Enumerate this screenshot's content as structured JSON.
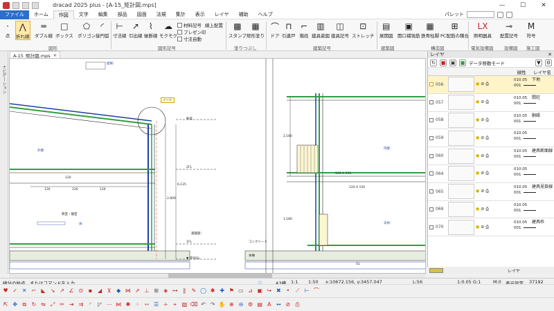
{
  "app": {
    "title": "dracad 2025 plus - [A-15_矩計図.mps]"
  },
  "window": {
    "minimize": "—",
    "maximize": "☐",
    "close": "✕"
  },
  "menu": [
    "ファイル",
    "ホーム",
    "作図",
    "文字",
    "編集",
    "部品",
    "図面",
    "法規",
    "集計",
    "表示",
    "レイヤ",
    "補助",
    "ヘルプ"
  ],
  "menu_right": {
    "palette_label": "パレット"
  },
  "ribbon": {
    "buttons": [
      "点",
      "折れ線",
      "ダブル線",
      "ボックス",
      "ポリゴン",
      "接円弧",
      "寸法線",
      "引出線",
      "破断線",
      "モクモク",
      "スタンプ",
      "矩形塗り",
      "ドア",
      "引違戸",
      "階段",
      "建具姿図",
      "建具記号",
      "ストレッチ",
      "展開図",
      "開口補強筋",
      "鉄骨柱脚",
      "PC配筋の積合",
      "照明器具",
      "配置記号",
      "符号"
    ],
    "small": [
      "材料記号",
      "プレゼン印",
      "寸法自動",
      "線上配置"
    ],
    "groups": [
      "図形",
      "図形記号",
      "塗りつぶし",
      "建築記号",
      "建築図",
      "構造図",
      "電気設備図",
      "設備図",
      "施工図"
    ]
  },
  "document": {
    "tab_label": "A-15_矩計図.mps",
    "close": "×"
  },
  "side_tab": "ナビゲーション",
  "canvas_labels": {
    "section_marks": [
      "軒高",
      "2FL",
      "1FL",
      "▼ 平均GL"
    ],
    "rooms": [
      "和室・寝室",
      "本棟"
    ],
    "callouts": [
      "屋根:",
      "外壁:",
      "内壁:",
      "床:",
      "天井:"
    ],
    "dims": [
      "120",
      "126",
      "126",
      "126",
      "2,800",
      "6,135",
      "2,160",
      "1,180",
      "120 X 150",
      "120 X 150"
    ],
    "notes": [
      "基礎部:",
      "コンクリート",
      "GL"
    ],
    "status_bubble": "ノート"
  },
  "layer_panel": {
    "title": "レイヤ",
    "close": "✕",
    "mode_label": "データ移動モード",
    "columns": [
      "",
      "顔性",
      "レイヤ名"
    ],
    "rows": [
      {
        "num": "056",
        "color": "010.05",
        "name": "下地"
      },
      {
        "num": "057",
        "color": "010.05",
        "name": "間柱"
      },
      {
        "num": "058",
        "color": "010.05",
        "name": "胴縁"
      },
      {
        "num": "059",
        "color": "010.05",
        "name": ""
      },
      {
        "num": "060",
        "color": "010.05",
        "name": "建具断面線"
      },
      {
        "num": "064",
        "color": "010.05",
        "name": ""
      },
      {
        "num": "065",
        "color": "010.05",
        "name": "建具見掛線"
      },
      {
        "num": "069",
        "color": "010.05",
        "name": ""
      },
      {
        "num": "070",
        "color": "010.05",
        "name": "建具枠"
      }
    ],
    "line_num": "001",
    "bottom": {
      "layer_tab": "レイヤ"
    }
  },
  "status": {
    "prompt": "線分の始点、またはコマンドを入力",
    "paper": "A3横",
    "scale1": "1:1",
    "scale2": "1:50",
    "coords": "x:10672.156, y:3457.047",
    "zoom": "L:56",
    "snap": "1:0.05  G:1",
    "mode": "M:0",
    "lock": "表示設定",
    "num": "37192",
    "caps": "CAP",
    "numl": "NUM",
    "electric": "電線"
  },
  "colors": {
    "accent": "#2a6fc9",
    "drawing_blue": "#1a3fa0",
    "hatch_green": "#2e9e3e"
  }
}
